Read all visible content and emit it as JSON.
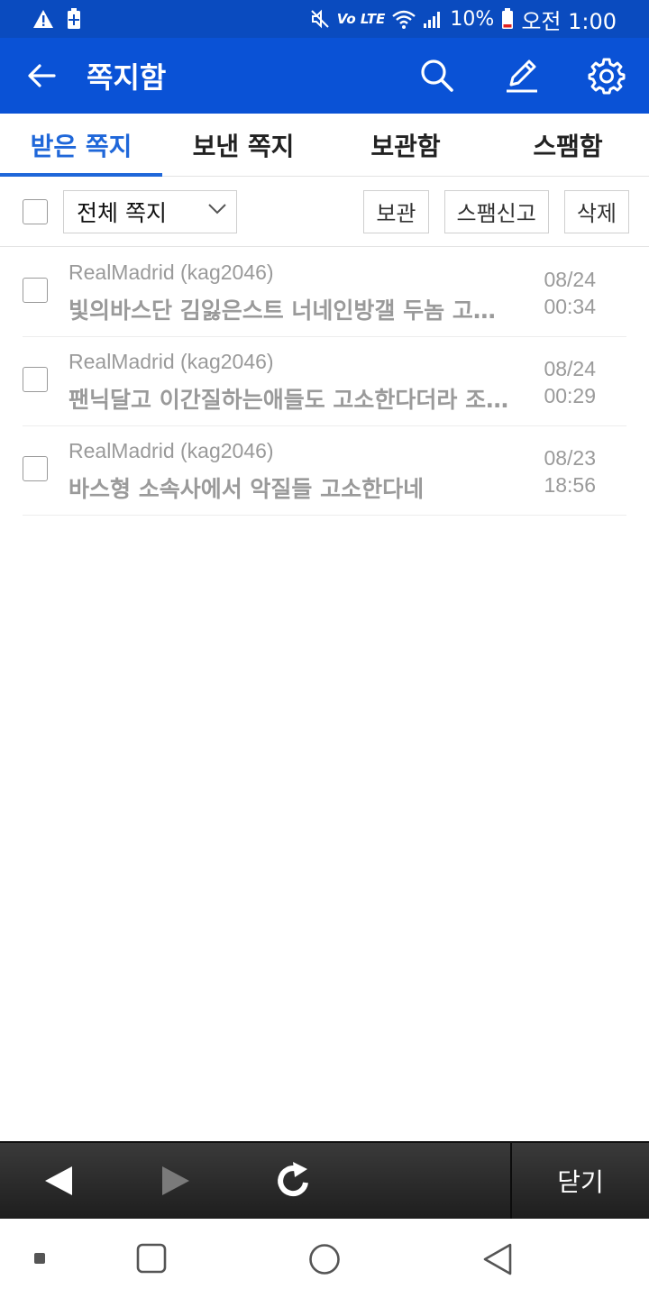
{
  "status_bar": {
    "battery": "10%",
    "time": "오전 1:00",
    "icons": [
      "warning-icon",
      "battery-saver-icon",
      "mute-icon",
      "volte-icon",
      "wifi-icon",
      "signal-icon",
      "battery-icon"
    ],
    "volte_label": "Vo LTE"
  },
  "app_bar": {
    "title": "쪽지함",
    "icons": [
      "back-arrow-icon",
      "search-icon",
      "pencil-icon",
      "gear-icon"
    ]
  },
  "tabs": [
    {
      "label": "받은 쪽지",
      "active": true
    },
    {
      "label": "보낸 쪽지",
      "active": false
    },
    {
      "label": "보관함",
      "active": false
    },
    {
      "label": "스팸함",
      "active": false
    }
  ],
  "toolbar": {
    "filter_value": "전체 쪽지",
    "buttons": [
      "보관",
      "스팸신고",
      "삭제"
    ]
  },
  "messages": [
    {
      "sender": "RealMadrid (kag2046)",
      "subject": "빛의바스단 김잃은스트 너네인방갤 두놈 고소한다",
      "date": "08/24",
      "time": "00:34"
    },
    {
      "sender": "RealMadrid (kag2046)",
      "subject": "팬닉달고 이간질하는애들도 고소한다더라 조심하세요",
      "date": "08/24",
      "time": "00:29"
    },
    {
      "sender": "RealMadrid (kag2046)",
      "subject": "바스형 소속사에서 악질들 고소한다네",
      "date": "08/23",
      "time": "18:56"
    }
  ],
  "bottom_bar": {
    "close_label": "닫기",
    "icons": [
      "back-triangle-icon",
      "forward-triangle-icon",
      "refresh-icon"
    ]
  },
  "system_nav": {
    "icons": [
      "dot-icon",
      "recents-icon",
      "home-icon",
      "back-icon"
    ]
  },
  "colors": {
    "status_bar": "#0a4bbf",
    "app_bar": "#0a52d6",
    "active_tab": "#1f67d9",
    "muted_text": "#9a9a9a"
  }
}
